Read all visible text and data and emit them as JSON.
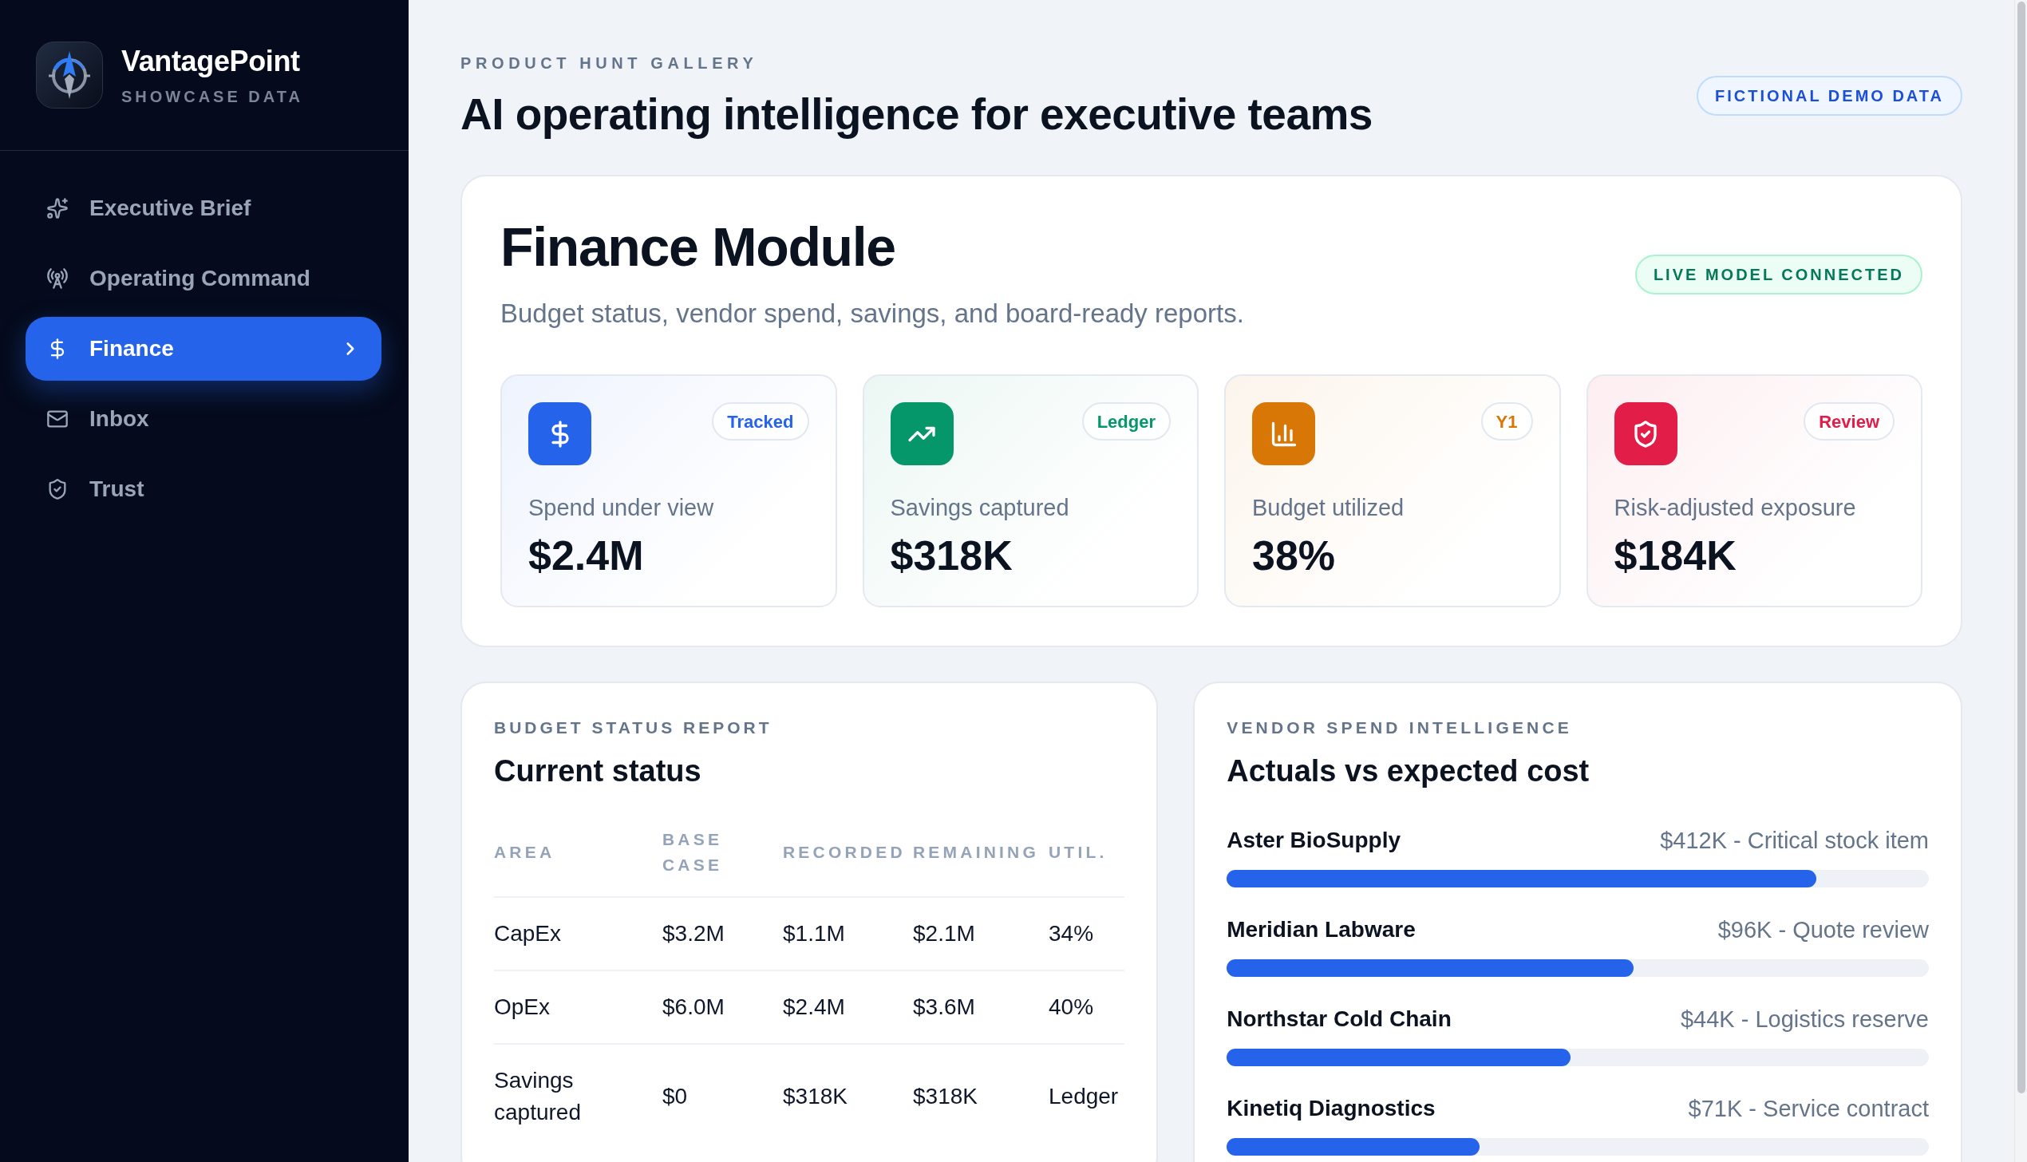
{
  "sidebar": {
    "brand": {
      "name": "VantagePoint",
      "tagline": "SHOWCASE DATA"
    },
    "nav": [
      {
        "label": "Executive Brief",
        "selected": false
      },
      {
        "label": "Operating Command",
        "selected": false
      },
      {
        "label": "Finance",
        "selected": true
      },
      {
        "label": "Inbox",
        "selected": false
      },
      {
        "label": "Trust",
        "selected": false
      }
    ]
  },
  "header": {
    "eyebrow": "PRODUCT HUNT GALLERY",
    "title": "AI operating intelligence for executive teams",
    "badge": "FICTIONAL DEMO DATA"
  },
  "module": {
    "title": "Finance Module",
    "subtitle": "Budget status, vendor spend, savings, and board-ready reports.",
    "status_badge": "LIVE MODEL CONNECTED",
    "metrics": [
      {
        "label": "Spend under view",
        "value": "$2.4M",
        "tag": "Tracked",
        "color": "#2563eb"
      },
      {
        "label": "Savings captured",
        "value": "$318K",
        "tag": "Ledger",
        "color": "#059669"
      },
      {
        "label": "Budget utilized",
        "value": "38%",
        "tag": "Y1",
        "color": "#d97706"
      },
      {
        "label": "Risk-adjusted exposure",
        "value": "$184K",
        "tag": "Review",
        "color": "#e11d48"
      }
    ]
  },
  "budget_report": {
    "eyebrow": "BUDGET STATUS REPORT",
    "title": "Current status",
    "table": {
      "columns": [
        "AREA",
        "BASE CASE",
        "RECORDED",
        "REMAINING",
        "UTIL."
      ],
      "rows": [
        [
          "CapEx",
          "$3.2M",
          "$1.1M",
          "$2.1M",
          "34%"
        ],
        [
          "OpEx",
          "$6.0M",
          "$2.4M",
          "$3.6M",
          "40%"
        ],
        [
          "Savings captured",
          "$0",
          "$318K",
          "$318K",
          "Ledger"
        ]
      ]
    }
  },
  "vendor_spend": {
    "eyebrow": "VENDOR SPEND INTELLIGENCE",
    "title": "Actuals vs expected cost",
    "vendors": [
      {
        "name": "Aster BioSupply",
        "detail": "$412K - Critical stock item",
        "level": 0.84
      },
      {
        "name": "Meridian Labware",
        "detail": "$96K - Quote review",
        "level": 0.58
      },
      {
        "name": "Northstar Cold Chain",
        "detail": "$44K - Logistics reserve",
        "level": 0.49
      },
      {
        "name": "Kinetiq Diagnostics",
        "detail": "$71K - Service contract",
        "level": 0.36
      }
    ]
  }
}
